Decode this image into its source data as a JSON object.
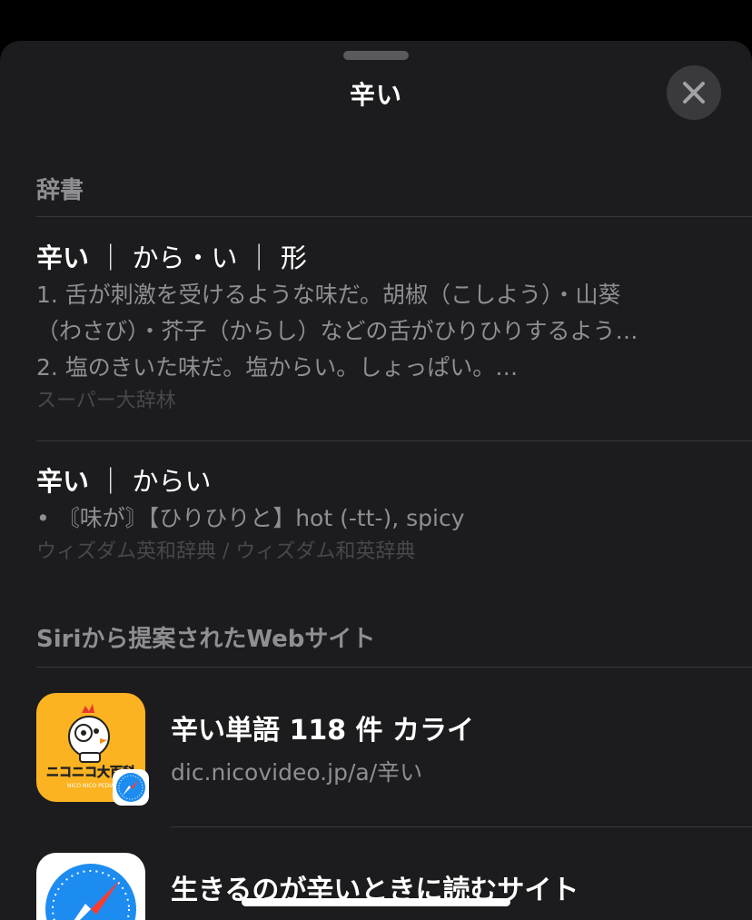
{
  "sheet": {
    "title": "辛い",
    "close_icon": "close-x-icon"
  },
  "dictionary": {
    "header": "辞書",
    "entries": [
      {
        "word": "辛い",
        "reading": "｜ から・い ｜ 形",
        "lines": [
          "1. 舌が刺激を受けるような味だ。胡椒（こしよう）・山葵",
          "（わさび）・芥子（からし）などの舌がひりひりするよう…",
          "2. 塩のきいた味だ。塩からい。しょっぱい。…"
        ],
        "source": "スーパー大辞林"
      },
      {
        "word": "辛い",
        "reading": "｜ からい",
        "lines": [
          "• 〘味が〙【ひりひりと】hot (-tt-), spicy"
        ],
        "source": "ウィズダム英和辞典 / ウィズダム和英辞典"
      }
    ]
  },
  "siri": {
    "header": "Siriから提案されたWebサイト",
    "sites": [
      {
        "title": "辛い単語 118 件 カライ",
        "url": "dic.nicovideo.jp/a/辛い",
        "logo_text": "ニコニコ大百科",
        "logo_subtext": "NICO NICO PEDIA",
        "thumb_color": "#fbb321",
        "badge_icon": "safari-compass-icon"
      },
      {
        "title": "生きるのが辛いときに読むサイト",
        "url": "",
        "thumb_color": "#ffffff",
        "icon": "safari-compass-icon"
      }
    ]
  },
  "colors": {
    "sheet_bg": "#1c1c1e",
    "secondary_text": "#8e8e93",
    "tertiary_text": "#48484a",
    "separator": "#38383a"
  }
}
